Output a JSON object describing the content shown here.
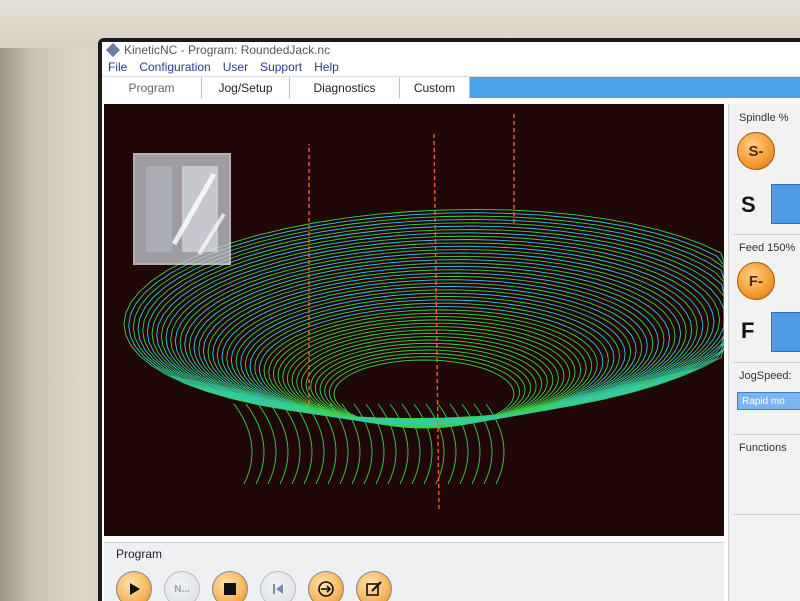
{
  "window": {
    "title": "KineticNC - Program: RoundedJack.nc"
  },
  "menu": [
    "File",
    "Configuration",
    "User",
    "Support",
    "Help"
  ],
  "tabs": [
    {
      "label": "Program",
      "active": true
    },
    {
      "label": "Jog/Setup",
      "active": false
    },
    {
      "label": "Diagnostics",
      "active": false
    },
    {
      "label": "Custom",
      "active": false
    }
  ],
  "right_panel": {
    "spindle_label": "Spindle %",
    "spindle_minus": "S-",
    "spindle_letter": "S",
    "feed_label": "Feed 150%",
    "feed_minus": "F-",
    "feed_letter": "F",
    "jogspeed_label": "JogSpeed:",
    "jogspeed_value": "Rapid mo",
    "functions_label": "Functions"
  },
  "program_bar": {
    "label": "Program",
    "buttons": [
      {
        "icon": "play-icon",
        "enabled": true
      },
      {
        "icon": "next-line-icon",
        "text": "N...",
        "enabled": false
      },
      {
        "icon": "stop-icon",
        "enabled": true
      },
      {
        "icon": "rewind-icon",
        "enabled": false
      },
      {
        "icon": "goto-line-icon",
        "enabled": true
      },
      {
        "icon": "edit-icon",
        "enabled": true
      }
    ]
  },
  "colors": {
    "toolpath_cut": "#3bd14a",
    "toolpath_rapid": "#2fc8e8",
    "toolpath_plunge": "#ff5a2a",
    "viewport_bg": "#200808",
    "tab_accent": "#4aa3ea",
    "button_orange": "#f29a2e"
  }
}
